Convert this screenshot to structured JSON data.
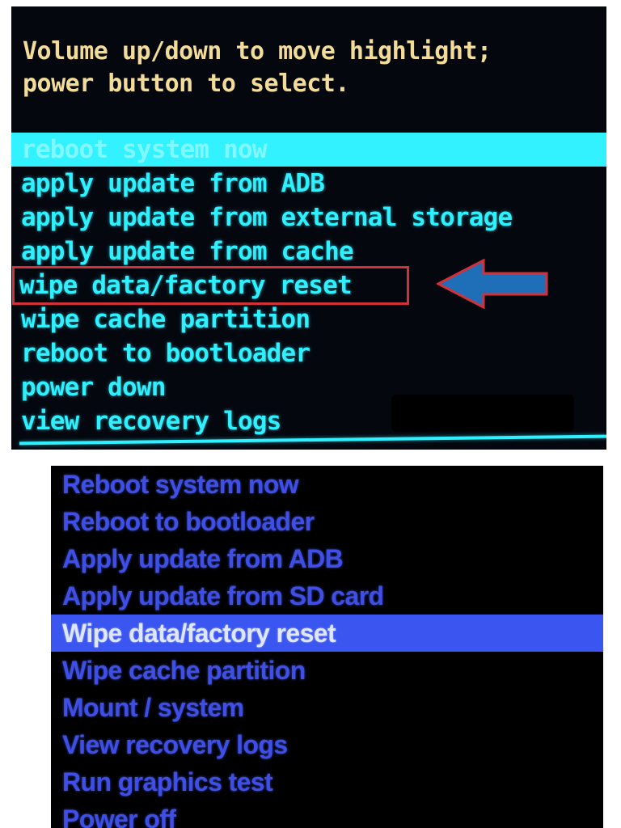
{
  "top_recovery": {
    "instructions": "Volume up/down to move highlight;\npower button to select.",
    "menu": [
      {
        "label": "reboot system now"
      },
      {
        "label": "apply update from ADB"
      },
      {
        "label": "apply update from external storage"
      },
      {
        "label": "apply update from cache"
      },
      {
        "label": "wipe data/factory reset"
      },
      {
        "label": "wipe cache partition"
      },
      {
        "label": "reboot to bootloader"
      },
      {
        "label": "power down"
      },
      {
        "label": "view recovery logs"
      }
    ],
    "selected_item": "reboot system now",
    "annotated_item": "wipe data/factory reset",
    "colors": {
      "background": "#05070f",
      "header_text": "#f2dc97",
      "menu_text": "#2ef0ff",
      "highlight": "#33f2ff",
      "annotation_box": "#d2313a",
      "annotation_arrow": "#1f6fb8"
    }
  },
  "bottom_recovery": {
    "menu": [
      {
        "label": "Reboot system now"
      },
      {
        "label": "Reboot to bootloader"
      },
      {
        "label": "Apply update from ADB"
      },
      {
        "label": "Apply update from SD card"
      },
      {
        "label": "Wipe data/factory reset"
      },
      {
        "label": "Wipe cache partition"
      },
      {
        "label": "Mount / system"
      },
      {
        "label": "View recovery logs"
      },
      {
        "label": "Run graphics test"
      },
      {
        "label": "Power off"
      }
    ],
    "selected_item": "Wipe data/factory reset",
    "colors": {
      "background": "#000000",
      "menu_text": "#3f4fe6",
      "highlight": "#3a55f0",
      "highlight_text": "#dfe6ff"
    }
  }
}
